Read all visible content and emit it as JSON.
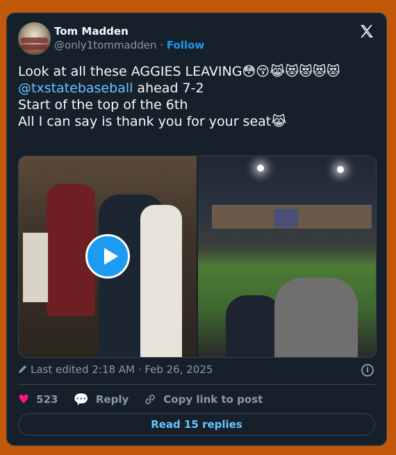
{
  "author": {
    "name": "Tom Madden",
    "handle": "@only1tommadden",
    "separator": " · ",
    "follow_label": "Follow"
  },
  "tweet": {
    "line1": "Look at all these AGGIES LEAVING😳😚😹😻😻😻😻",
    "mention": "@txstatebaseball",
    "line2_rest": " ahead 7-2",
    "line3": "Start of the top of the 6th",
    "line4": "All I can say is thank you for your seat😹"
  },
  "meta": {
    "edited": "Last edited 2:18 AM · Feb 26, 2025"
  },
  "actions": {
    "likes": "523",
    "reply_label": "Reply",
    "copy_label": "Copy link to post"
  },
  "replies_button": "Read 15 replies",
  "icons": {
    "logo": "x-logo-icon",
    "play": "play-icon",
    "edit": "pencil-icon",
    "info": "info-icon",
    "like": "heart-icon",
    "reply": "reply-bubble-icon",
    "copy": "link-icon"
  },
  "colors": {
    "accent": "#1d9bf0",
    "like": "#f91880",
    "background": "#15202b",
    "page": "#c2590a"
  }
}
